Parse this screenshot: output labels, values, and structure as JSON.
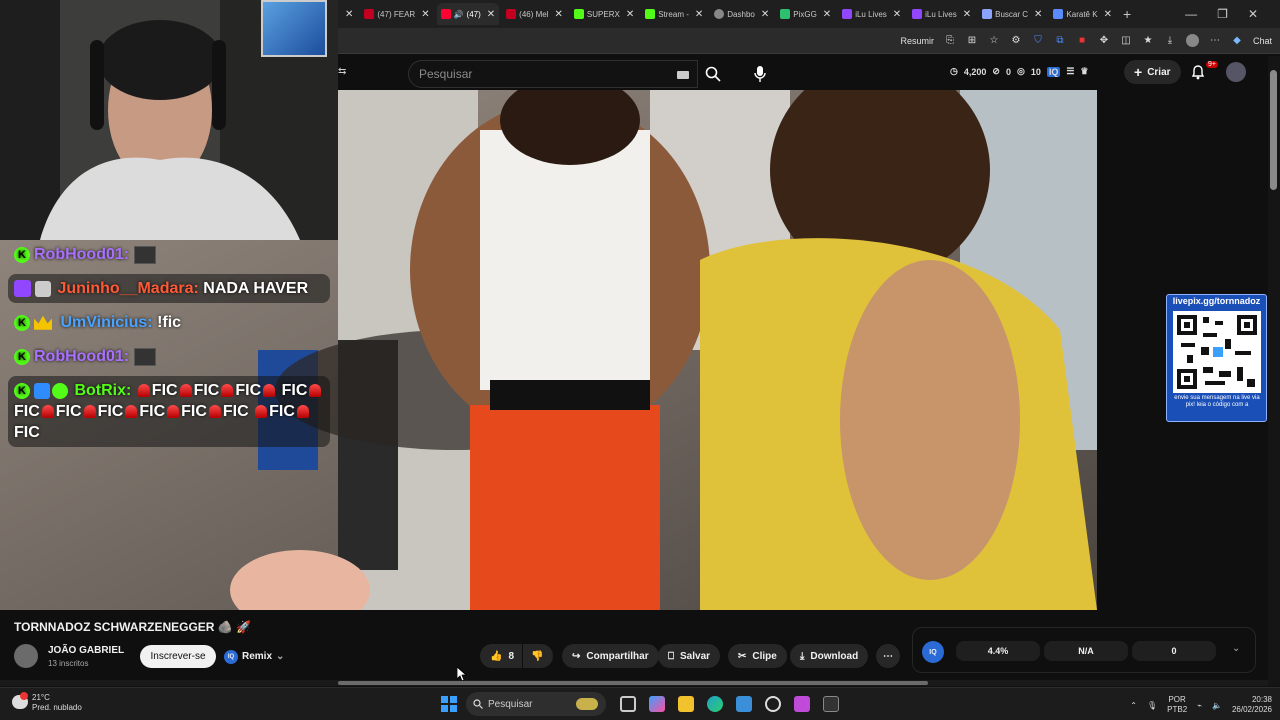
{
  "browser": {
    "tabs": [
      {
        "label": "",
        "favicon_color": "#c40022",
        "active": false
      },
      {
        "label": "(47) FEAR",
        "favicon_color": "#c40022",
        "active": false
      },
      {
        "label": "(47)",
        "favicon_color": "#ff0033",
        "active": true
      },
      {
        "label": "(46) Mel",
        "favicon_color": "#c40022",
        "active": false
      },
      {
        "label": "SUPERX",
        "favicon_color": "#53fc18",
        "active": false
      },
      {
        "label": "Stream -",
        "favicon_color": "#53fc18",
        "active": false
      },
      {
        "label": "Dashbo",
        "favicon_color": "#888888",
        "active": false
      },
      {
        "label": "PixGG",
        "favicon_color": "#2fbf71",
        "active": false
      },
      {
        "label": "iLu Lives",
        "favicon_color": "#9146ff",
        "active": false
      },
      {
        "label": "iLu Lives",
        "favicon_color": "#9146ff",
        "active": false
      },
      {
        "label": "Buscar C",
        "favicon_color": "#8aa4ff",
        "active": false
      },
      {
        "label": "Karatê K",
        "favicon_color": "#5a8cff",
        "active": false
      }
    ],
    "toolbar": {
      "resume_label": "Resumir",
      "chat_label": "Chat"
    }
  },
  "youtube": {
    "search_placeholder": "Pesquisar",
    "stats": {
      "views": "4,200",
      "likes": "0",
      "viewers": "10"
    },
    "create_label": "Criar",
    "notification_badge": "9+"
  },
  "chat": {
    "messages": [
      {
        "user": "RobHood01:",
        "text": "",
        "user_color": "#a970ff",
        "platform": "kick"
      },
      {
        "user": "Juninho__Madara:",
        "text": "NADA HAVER",
        "user_color": "#ff5a36",
        "platform": "twitch"
      },
      {
        "user": "UmVinicius:",
        "text": "!fic",
        "user_color": "#4aa3ff",
        "platform": "kick"
      },
      {
        "user": "RobHood01:",
        "text": "",
        "user_color": "#a970ff",
        "platform": "kick"
      },
      {
        "user": "BotRix:",
        "fic": "FIC",
        "user_color": "#53fc18",
        "platform": "kick"
      }
    ]
  },
  "qr": {
    "label": "livepix.gg/tornnadoz",
    "caption": "envie sua mensagem na live via pix! leia o código com a"
  },
  "video": {
    "title": "TORNNADOZ SCHWARZENEGGER",
    "channel": "JOÃO GABRIEL",
    "subscribers": "13 inscritos",
    "subscribe_label": "Inscrever-se",
    "remix_label": "Remix",
    "likes": "8",
    "share_label": "Compartilhar",
    "save_label": "Salvar",
    "clip_label": "Clipe",
    "download_label": "Download"
  },
  "iq_panel": {
    "logo": "IQ",
    "stat1": "4.4%",
    "stat2": "N/A",
    "stat3": "0"
  },
  "taskbar": {
    "temperature": "21°C",
    "weather": "Pred. nublado",
    "search_placeholder": "Pesquisar",
    "lang1": "POR",
    "lang2": "PTB2",
    "time": "20:38",
    "date": "26/02/2026"
  }
}
